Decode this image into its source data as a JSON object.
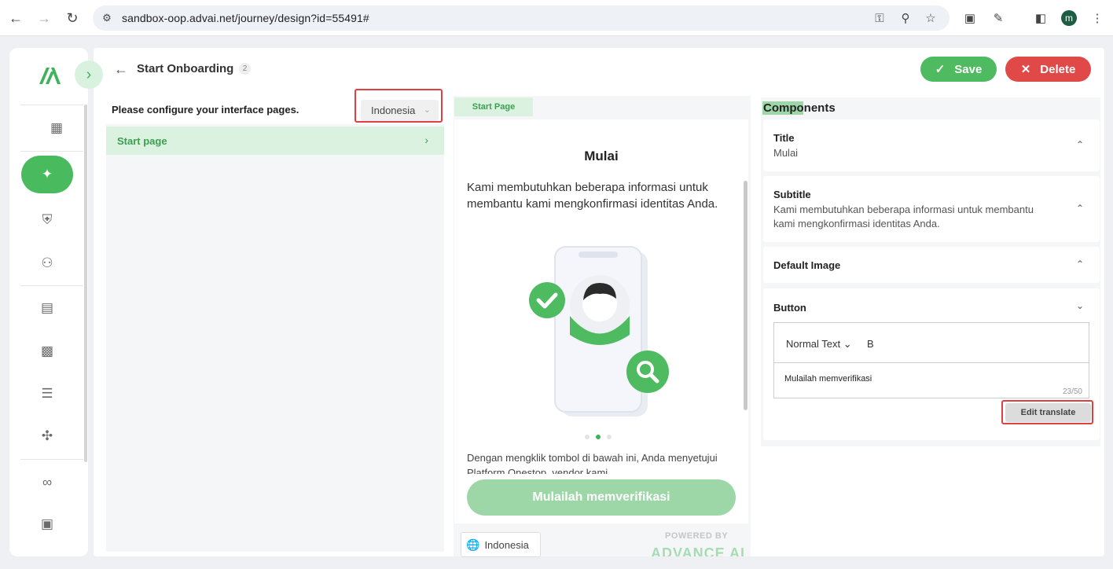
{
  "browser": {
    "url": "sandbox-oop.advai.net/journey/design?id=55491#",
    "profile_initial": "m"
  },
  "header": {
    "title": "Start Onboarding",
    "badge": "2",
    "save_label": "Save",
    "delete_label": "Delete"
  },
  "left_panel": {
    "config_label": "Please configure your interface pages.",
    "language": "Indonesia",
    "pages": [
      {
        "label": "Start page"
      }
    ]
  },
  "preview": {
    "tab_label": "Start Page",
    "title": "Mulai",
    "subtitle": "Kami membutuhkan beberapa informasi untuk membantu kami mengkonfirmasi identitas Anda.",
    "consent": "Dengan mengklik tombol di bawah ini, Anda menyetujui Platform Onestop, vendor kami",
    "button_label": "Mulailah memverifikasi",
    "language": "Indonesia",
    "powered_by": "POWERED BY",
    "brand": "ADVANCE AI",
    "active_dot": 1
  },
  "components": {
    "heading": "Components",
    "title_label": "Title",
    "title_value": "Mulai",
    "subtitle_label": "Subtitle",
    "subtitle_value": "Kami membutuhkan beberapa informasi untuk membantu kami mengkonfirmasi identitas Anda.",
    "image_label": "Default Image",
    "button_label": "Button",
    "editor_format": "Normal Text",
    "editor_bold": "B",
    "editor_content": "Mulailah memverifikasi",
    "char_count": "23/50",
    "edit_translate": "Edit translate"
  },
  "colors": {
    "accent_green": "#4fbb60",
    "light_green": "#dcf2e1",
    "delete_red": "#e14848",
    "highlight_red": "#e14040"
  },
  "icons": [
    "back-icon",
    "forward-icon",
    "reload-icon",
    "site-settings-icon",
    "key-icon",
    "zoom-icon",
    "star-icon",
    "extension-icon",
    "sidebar-icon",
    "menu-icon",
    "dashboard-icon",
    "journey-icon",
    "shield-icon",
    "users-icon",
    "document-icon",
    "calculator-icon",
    "list-icon",
    "workflow-icon",
    "link-icon",
    "apps-icon",
    "globe-icon"
  ]
}
